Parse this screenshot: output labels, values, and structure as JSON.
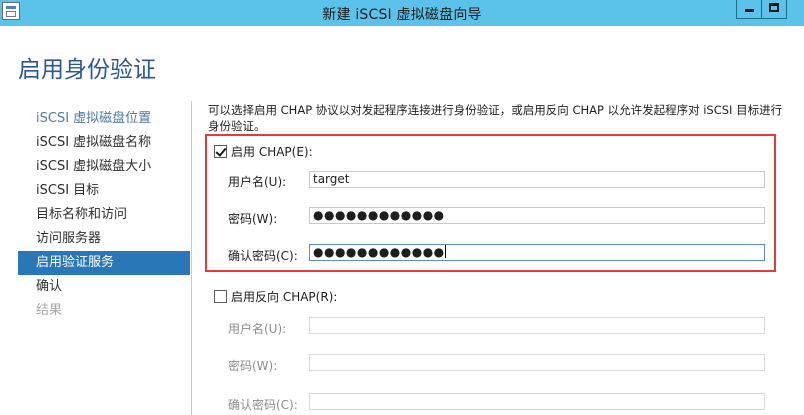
{
  "window": {
    "title": "新建 iSCSI 虚拟磁盘向导"
  },
  "page": {
    "title": "启用身份验证"
  },
  "nav": {
    "items": [
      {
        "label": "iSCSI 虚拟磁盘位置",
        "state": "link"
      },
      {
        "label": "iSCSI 虚拟磁盘名称",
        "state": "completed"
      },
      {
        "label": "iSCSI 虚拟磁盘大小",
        "state": "completed"
      },
      {
        "label": "iSCSI 目标",
        "state": "completed"
      },
      {
        "label": "目标名称和访问",
        "state": "completed"
      },
      {
        "label": "访问服务器",
        "state": "completed"
      },
      {
        "label": "启用验证服务",
        "state": "active"
      },
      {
        "label": "确认",
        "state": "completed"
      },
      {
        "label": "结果",
        "state": "disabled"
      }
    ]
  },
  "description": {
    "line1": "可以选择启用 CHAP 协议以对发起程序连接进行身份验证，或启用反向 CHAP 以允许发起程序对 iSCSI 目标进行",
    "line2": "身份验证。"
  },
  "chap": {
    "checkbox_label": "启用 CHAP(E):",
    "checked": true,
    "username_label": "用户名(U):",
    "username_value": "target",
    "password_label": "密码(W):",
    "password_value": "●●●●●●●●●●●●",
    "confirm_label": "确认密码(C):",
    "confirm_value": "●●●●●●●●●●●●"
  },
  "reverse_chap": {
    "checkbox_label": "启用反向 CHAP(R):",
    "checked": false,
    "username_label": "用户名(U):",
    "username_value": "",
    "password_label": "密码(W):",
    "password_value": "",
    "confirm_label": "确认密码(C):",
    "confirm_value": ""
  },
  "colors": {
    "titlebar": "#5bc3ea",
    "page_title": "#2b5797",
    "nav_active_bg": "#2a77b7",
    "highlight_border": "#e33b3b"
  },
  "icons": {
    "app": "wizard-window-icon",
    "minimize": "minimize-icon",
    "maximize": "maximize-icon"
  }
}
